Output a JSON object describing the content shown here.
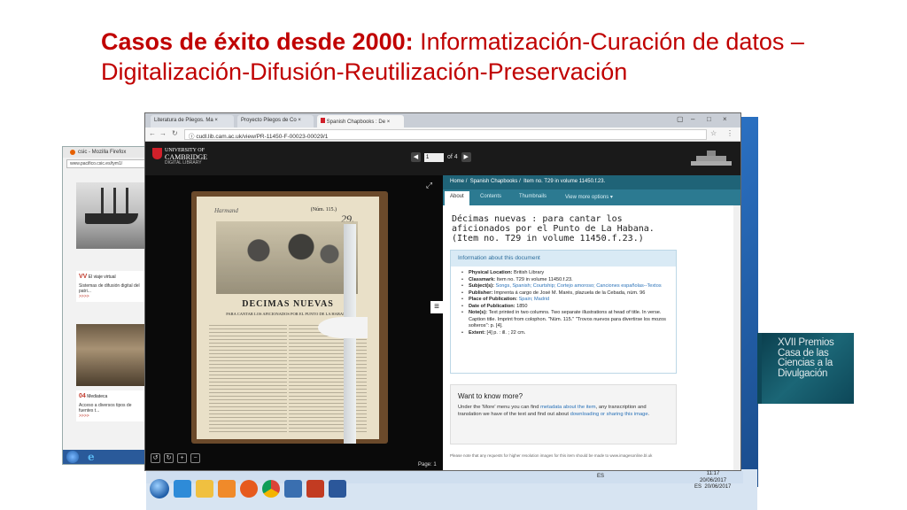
{
  "slide": {
    "title_bold": "Casos de éxito desde  2000:",
    "title_rest": " Informatización-Curación de datos –Digitalización-Difusión-Reutilización-Preservación"
  },
  "firefox": {
    "title": "csic - Mozilla Firefox",
    "url": "www.pacifico.csic.es/tym1/",
    "card1_num": "VV",
    "card1_title": "El viaje virtual",
    "card1_text": "Sistemas de difusión digital del patri...",
    "card1_more": ">>>>",
    "card2_num": "04",
    "card2_title": "Mediateca",
    "card2_text": "Acceso a diversos tipos de fuentes t...",
    "card2_more": ">>>>"
  },
  "browser": {
    "tabs": [
      {
        "label": "Literatura de Pliegos. Ma"
      },
      {
        "label": "Proyecto Pliegos de Co"
      },
      {
        "label": "Spanish Chapbooks : De"
      }
    ],
    "url": "cudl.lib.cam.ac.uk/view/PR-11450-F-00023-00029/1"
  },
  "cudl": {
    "logo_line1": "UNIVERSITY OF",
    "logo_line2": "CAMBRIDGE",
    "logo_line3": "DIGITAL LIBRARY",
    "page_input": "1",
    "page_of": "of 4",
    "page_label": "Page: 1"
  },
  "scan": {
    "handwriting": "Harmand",
    "num": "(Núm. 115.)",
    "big": "29.",
    "heading": "DECIMAS NUEVAS",
    "subheading": "PARA CANTAR LOS AFICIONADOS POR EL PUNTO DE LA HABANA."
  },
  "panel": {
    "breadcrumb_home": "Home",
    "breadcrumb_sep1": "/",
    "breadcrumb_col": "Spanish Chapbooks",
    "breadcrumb_sep2": "/",
    "breadcrumb_item": "Item no. T29 in volume 11450.f.23.",
    "tabs": [
      "About",
      "Contents",
      "Thumbnails",
      "View more options ▾"
    ],
    "doc_title": "Décimas nuevas : para cantar los aficionados por el Punto de La Habana. (Item no. T29 in volume 11450.f.23.)",
    "info_heading": "Information about this document",
    "fields": [
      {
        "label": "Physical Location:",
        "value": " British Library"
      },
      {
        "label": "Classmark:",
        "value": " Item no. T29 in volume 11450.f.23."
      },
      {
        "label": "Subject(s):",
        "value": " Songs, Spanish; Courtship; Cortejo amoroso; Canciones españolas--Textos"
      },
      {
        "label": "Publisher:",
        "value": " Imprenta á cargo de José M. Marés, plazuela de la Cebada, núm. 96"
      },
      {
        "label": "Place of Publication:",
        "value": " Spain; Madrid"
      },
      {
        "label": "Date of Publication:",
        "value": " 1850"
      },
      {
        "label": "Note(s):",
        "value": " Text printed in two columns. Two separate illustrations at head of title. In verse. Caption title. Imprint from colophon. \"Núm. 115.\" \"Trovos nuevos para divertirse los mozos solteros\": p. [4]."
      },
      {
        "label": "Extent:",
        "value": " [4] p. : ill. ; 22 cm."
      }
    ],
    "more_heading": "Want to know more?",
    "more_text_a": "Under the 'More' menu you can find ",
    "more_link1": "metadata about the item",
    "more_text_b": ", any transcription and translation we have of the text and find out about ",
    "more_link2": "downloading or sharing this image",
    "more_text_c": ".",
    "footnote": "Please note that any requests for higher resolution images for this item should be made to www.imagesonline.bl.uk"
  },
  "taskbar": {
    "lang": "ES",
    "time1": "11:17",
    "date1": "20/06/2017",
    "lang2": "ES",
    "date2": "20/06/2017"
  },
  "premios": {
    "line1": "XVII Premios",
    "line2": "Casa de las",
    "line3": "Ciencias a la",
    "line4": "Divulgación"
  },
  "colors": {
    "title_red": "#c00000",
    "cudl_teal": "#1f6377",
    "link_blue": "#2a72b8"
  }
}
